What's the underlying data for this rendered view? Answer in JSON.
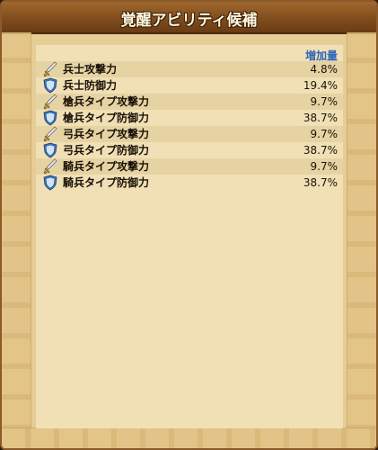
{
  "title": "覚醒アビリティ候補",
  "header": {
    "increase_label": "増加量"
  },
  "rows": [
    {
      "icon": "sword-icon",
      "label": "兵士攻撃力",
      "value": "4.8%"
    },
    {
      "icon": "shield-icon",
      "label": "兵士防御力",
      "value": "19.4%"
    },
    {
      "icon": "sword-icon",
      "label": "槍兵タイプ攻撃力",
      "value": "9.7%"
    },
    {
      "icon": "shield-icon",
      "label": "槍兵タイプ防御力",
      "value": "38.7%"
    },
    {
      "icon": "sword-icon",
      "label": "弓兵タイプ攻撃力",
      "value": "9.7%"
    },
    {
      "icon": "shield-icon",
      "label": "弓兵タイプ防御力",
      "value": "38.7%"
    },
    {
      "icon": "sword-icon",
      "label": "騎兵タイプ攻撃力",
      "value": "9.7%"
    },
    {
      "icon": "shield-icon",
      "label": "騎兵タイプ防御力",
      "value": "38.7%"
    }
  ],
  "colors": {
    "header_blue": "#2e66b8",
    "frame_brown": "#7d4a1c",
    "parchment": "#f1e0b6"
  }
}
